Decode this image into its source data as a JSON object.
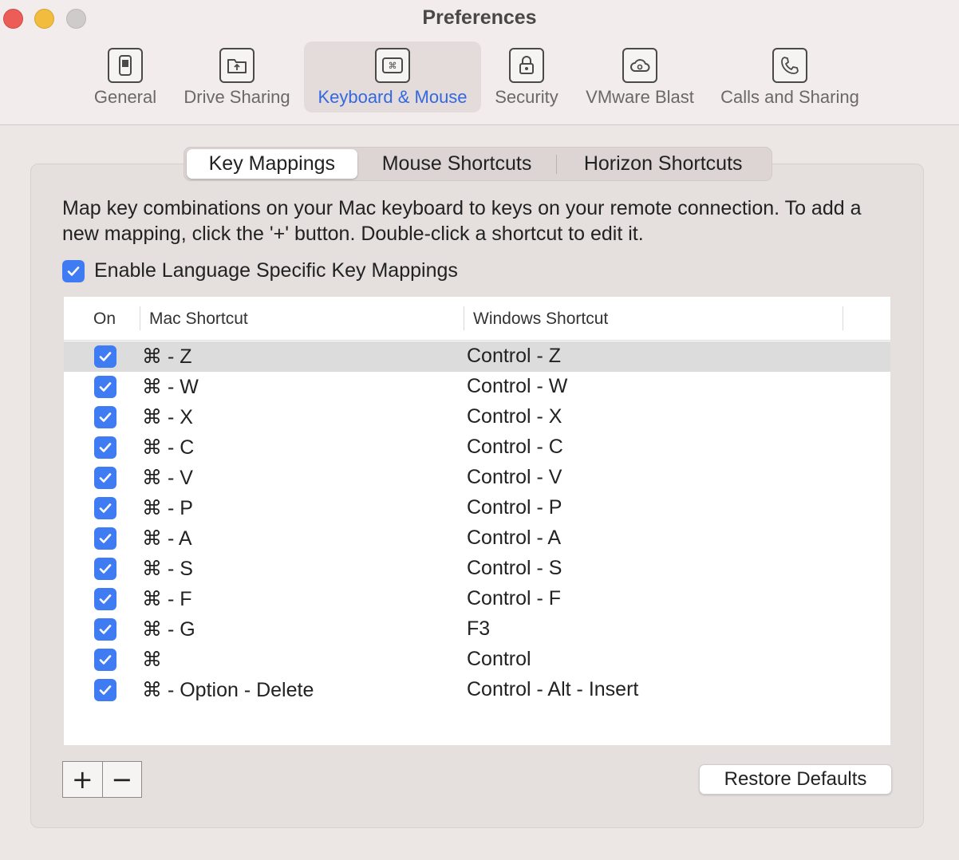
{
  "window": {
    "title": "Preferences"
  },
  "toolbar": [
    {
      "key": "general",
      "label": "General",
      "icon": "phone-device-icon"
    },
    {
      "key": "drive",
      "label": "Drive Sharing",
      "icon": "folder-upload-icon"
    },
    {
      "key": "keyboard",
      "label": "Keyboard & Mouse",
      "icon": "command-key-icon",
      "active": true
    },
    {
      "key": "security",
      "label": "Security",
      "icon": "lock-icon"
    },
    {
      "key": "vmware",
      "label": "VMware Blast",
      "icon": "cloud-gear-icon"
    },
    {
      "key": "calls",
      "label": "Calls and Sharing",
      "icon": "phone-handset-icon"
    }
  ],
  "tabs": [
    {
      "label": "Key Mappings",
      "active": true
    },
    {
      "label": "Mouse Shortcuts"
    },
    {
      "label": "Horizon Shortcuts"
    }
  ],
  "description": "Map key combinations on your Mac keyboard to keys on your remote connection.  To add a new mapping, click the '+' button. Double-click a shortcut to edit it.",
  "enable_language": {
    "label": "Enable Language Specific Key Mappings",
    "checked": true
  },
  "table": {
    "headers": {
      "on": "On",
      "mac": "Mac Shortcut",
      "windows": "Windows Shortcut"
    },
    "rows": [
      {
        "on": true,
        "mac": "⌘ - Z",
        "windows": "Control - Z",
        "selected": true
      },
      {
        "on": true,
        "mac": "⌘ - W",
        "windows": "Control - W"
      },
      {
        "on": true,
        "mac": "⌘ - X",
        "windows": "Control - X"
      },
      {
        "on": true,
        "mac": "⌘ - C",
        "windows": "Control - C"
      },
      {
        "on": true,
        "mac": "⌘ - V",
        "windows": "Control - V"
      },
      {
        "on": true,
        "mac": "⌘ - P",
        "windows": "Control - P"
      },
      {
        "on": true,
        "mac": "⌘ - A",
        "windows": "Control - A"
      },
      {
        "on": true,
        "mac": "⌘ - S",
        "windows": "Control - S"
      },
      {
        "on": true,
        "mac": "⌘ - F",
        "windows": "Control - F"
      },
      {
        "on": true,
        "mac": "⌘ - G",
        "windows": "F3"
      },
      {
        "on": true,
        "mac": "⌘",
        "windows": "Control"
      },
      {
        "on": true,
        "mac": "⌘ - Option - Delete",
        "windows": "Control - Alt - Insert"
      }
    ]
  },
  "buttons": {
    "add": "+",
    "remove": "−",
    "restore": "Restore Defaults"
  },
  "colors": {
    "accent": "#3f7cf4",
    "active_label": "#3468e0"
  }
}
